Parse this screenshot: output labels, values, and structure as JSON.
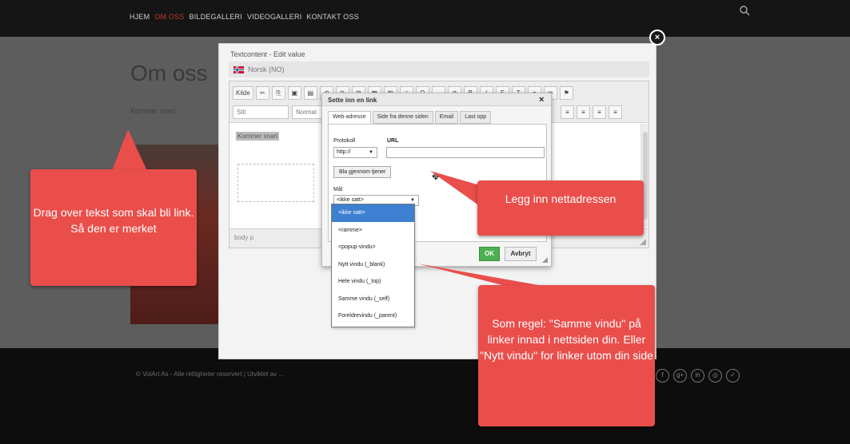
{
  "site": {
    "nav": [
      "HJEM",
      "OM OSS",
      "BILDEGALLERI",
      "VIDEOGALLERI",
      "KONTAKT OSS"
    ],
    "page_title": "Om oss",
    "page_text": "Kommer snart",
    "footer_text": "© VolArt As - Alle rettigheter reservert | Utviklet av ...",
    "social_icons": [
      "f",
      "g+",
      "in",
      "◎",
      "✓"
    ],
    "accent_color": "#c0392b"
  },
  "modal": {
    "title": "Textcontent - Edit value",
    "language": "Norsk (NO)",
    "close_label": "×",
    "toolbar_row1": [
      "Kilde",
      "✂",
      "⎘",
      "▣",
      "▤",
      "↶",
      "↷",
      "⊞",
      "▦",
      "▥",
      "≡",
      "Ω",
      "—",
      "⊘",
      "B",
      "I",
      "S",
      "T",
      "⚭",
      "⚮",
      "⚑"
    ],
    "style_combo": "Stil",
    "format_combo": "Normal",
    "toolbar_row2_right": [
      "≡",
      "≡",
      "≡",
      "≡"
    ],
    "editor_text": "Kommer snart",
    "path": "body  p"
  },
  "link_dialog": {
    "title": "Sette inn en link",
    "close_label": "×",
    "tabs": [
      "Web-adresse",
      "Side fra denne siden",
      "Email",
      "Last opp"
    ],
    "protocol_label": "Protokoll",
    "protocol_value": "http://",
    "url_label": "URL",
    "browse_label": "Bla gjennom tjener",
    "target_label": "Mål",
    "target_value": "<ikke satt>",
    "target_options": [
      "<ikke satt>",
      "<ramme>",
      "<popup-vindu>",
      "Nytt vindu (_blank)",
      "Hele vindu (_top)",
      "Samme vindu (_self)",
      "Foreldrevindu (_parent)"
    ],
    "ok_label": "OK",
    "cancel_label": "Avbryt"
  },
  "callouts": {
    "drag": "Drag over tekst som skal bli link. Så den er merket",
    "url": "Legg inn nettadressen",
    "target": "Som regel: \"Samme vindu\" på linker innad i nettsiden din. Eller \"Nytt vindu\" for linker utom din side",
    "color": "#ea4e4b"
  }
}
